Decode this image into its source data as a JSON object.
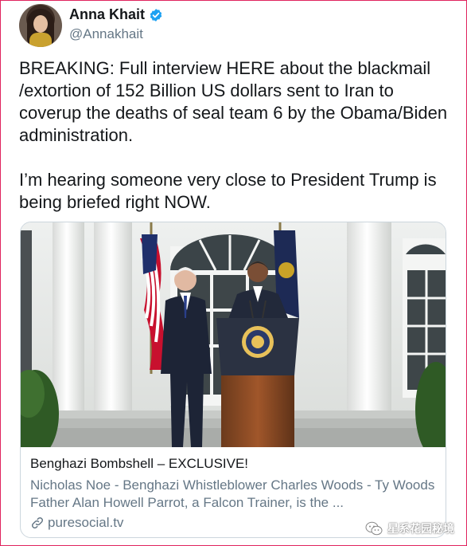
{
  "tweet": {
    "author": {
      "display_name": "Anna Khait",
      "handle": "@Annakhait",
      "verified": true
    },
    "text_paragraphs": [
      "BREAKING: Full interview HERE about the blackmail /extortion of 152 Billion US dollars sent to Iran to coverup the deaths of seal team 6 by the Obama/Biden administration.",
      "I’m hearing someone very close to President Trump is being briefed right NOW."
    ],
    "card": {
      "title": "Benghazi Bombshell – EXCLUSIVE!",
      "description": "Nicholas Noe - Benghazi Whistleblower Charles Woods - Ty Woods Father Alan Howell Parrot, a Falcon Trainer, is the ...",
      "domain": "puresocial.tv"
    }
  },
  "watermark": {
    "text": "星系花园秘境"
  },
  "colors": {
    "text_primary": "#14171a",
    "text_secondary": "#657786",
    "verified_blue": "#1da1f2",
    "card_border": "#ccd6dd",
    "frame_border": "#e0245e"
  },
  "icons": {
    "verified": "verified-badge-icon",
    "link": "link-icon",
    "watermark": "wechat-icon"
  }
}
